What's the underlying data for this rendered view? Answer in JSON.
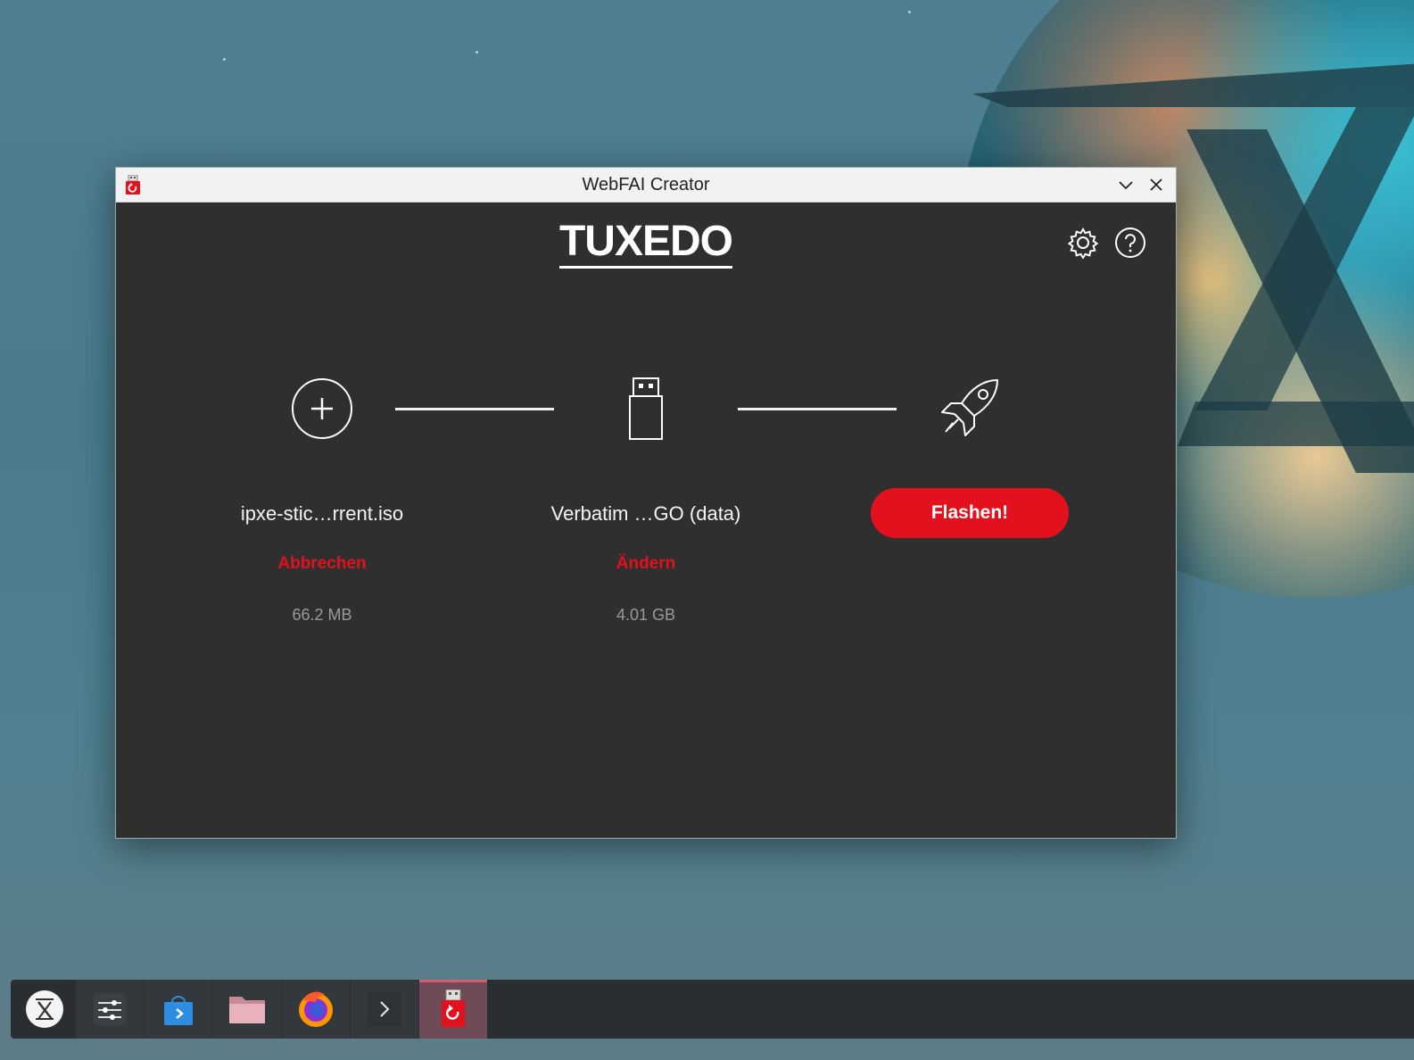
{
  "window": {
    "title": "WebFAI Creator"
  },
  "header": {
    "logo_text": "TUXEDO",
    "settings_icon": "gear-icon",
    "help_icon": "help-icon"
  },
  "steps": {
    "image": {
      "icon": "add-circle-icon",
      "label": "ipxe-stic…rrent.iso",
      "action": "Abbrechen",
      "size": "66.2 MB"
    },
    "drive": {
      "icon": "usb-drive-icon",
      "label": "Verbatim …GO (data)",
      "action": "Ändern",
      "size": "4.01 GB"
    },
    "flash": {
      "icon": "rocket-icon",
      "button_label": "Flashen!"
    }
  },
  "taskbar": {
    "items": [
      {
        "icon": "tuxedo-os-icon"
      },
      {
        "icon": "settings-sliders-icon"
      },
      {
        "icon": "store-bag-icon"
      },
      {
        "icon": "folder-icon"
      },
      {
        "icon": "firefox-icon"
      },
      {
        "icon": "terminal-icon"
      },
      {
        "icon": "webfai-creator-icon"
      }
    ]
  },
  "colors": {
    "accent": "#e3111d",
    "window_bg": "#2f2f2f",
    "titlebar_bg": "#f2f2f2",
    "taskbar_bg": "#2a2e32"
  }
}
